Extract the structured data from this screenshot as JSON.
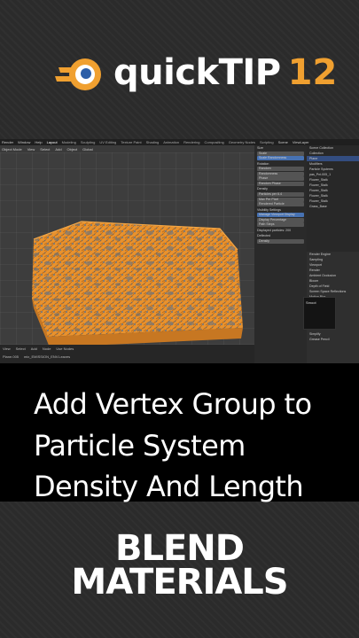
{
  "brand": {
    "word": "quickTIP",
    "number": "12",
    "logo_icon": "blender-logo-icon"
  },
  "screenshot": {
    "menubar": [
      "Render",
      "Window",
      "Help"
    ],
    "workspace_tabs": [
      "Layout",
      "Modeling",
      "Sculpting",
      "UV Editing",
      "Texture Paint",
      "Shading",
      "Animation",
      "Rendering",
      "Compositing",
      "Geometry Nodes",
      "Scripting"
    ],
    "header": [
      "Object Mode",
      "View",
      "Select",
      "Add",
      "Object",
      "Global"
    ],
    "scene_name": "Scene",
    "view_layer": "ViewLayer",
    "timeline": [
      "View",
      "Select",
      "Add",
      "Node",
      "Use Nodes"
    ],
    "breadcrumb": [
      "Plane.005",
      "mix_EMISSION_ENV.Leaves"
    ],
    "props": {
      "size_label": "Size",
      "fields": [
        "Scale",
        "Scale Randomness",
        "Random",
        "Randomness",
        "Phase",
        "Random Phase",
        "Density",
        "Particles per 6.4",
        "Max Per Pixel",
        "Rendered Particle",
        "Display Percentage",
        "Path Steps",
        "Density"
      ],
      "panels": [
        "Rotation",
        "Visibility Settings",
        "Manage Viewport Display",
        "Deflected"
      ],
      "info": "Displayed particles: 200"
    },
    "outliner": [
      "Scene Collection",
      "Collection",
      "Plane",
      "Modifiers",
      "Particle Systems",
      "pas_Pnt.005_1",
      "Flower_Stalk",
      "Flower_Stalk",
      "Flower_Stalk",
      "Flower_Stalk",
      "Flower_Stalk",
      "Grass_Base"
    ],
    "render": [
      "Render Engine",
      "Sampling",
      "Viewport",
      "Render",
      "Ambient Occlusion",
      "Bloom",
      "Depth of Field",
      "Screen Space Reflections",
      "Motion Blur",
      "Volumetrics",
      "Performance",
      "Hair",
      "Shadows",
      "Indirect Lighting",
      "Film",
      "Simplify",
      "Grease Pencil"
    ],
    "popup": "Smoot"
  },
  "caption": {
    "line1": "Add Vertex Group to",
    "line2": "Particle System",
    "line3": "Density And Length"
  },
  "footer": {
    "line1": "BLEND",
    "line2": "MATERIALS"
  },
  "colors": {
    "accent": "#f0a030",
    "particles": "#e8922e"
  }
}
